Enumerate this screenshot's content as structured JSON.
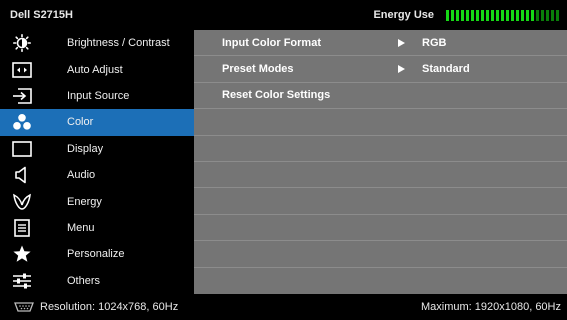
{
  "header": {
    "title": "Dell S2715H",
    "energy_label": "Energy Use",
    "energy_level": 0.78
  },
  "menu": {
    "items": [
      {
        "label": "Brightness / Contrast",
        "icon": "brightness-icon"
      },
      {
        "label": "Auto Adjust",
        "icon": "auto-adjust-icon"
      },
      {
        "label": "Input Source",
        "icon": "input-source-icon"
      },
      {
        "label": "Color",
        "icon": "color-icon"
      },
      {
        "label": "Display",
        "icon": "display-icon"
      },
      {
        "label": "Audio",
        "icon": "audio-icon"
      },
      {
        "label": "Energy",
        "icon": "energy-icon"
      },
      {
        "label": "Menu",
        "icon": "menu-icon"
      },
      {
        "label": "Personalize",
        "icon": "personalize-icon"
      },
      {
        "label": "Others",
        "icon": "others-icon"
      }
    ],
    "active_index": 3
  },
  "content": {
    "rows": [
      {
        "label": "Input Color Format",
        "value": "RGB"
      },
      {
        "label": "Preset Modes",
        "value": "Standard"
      },
      {
        "label": "Reset Color Settings",
        "value": ""
      }
    ]
  },
  "status": {
    "resolution": "Resolution: 1024x768, 60Hz",
    "maximum": "Maximum: 1920x1080, 60Hz"
  },
  "colors": {
    "accent": "#1c6fb7",
    "content_bg": "#757575",
    "energy_on": "#16d816",
    "energy_off": "#0a7d0a"
  }
}
